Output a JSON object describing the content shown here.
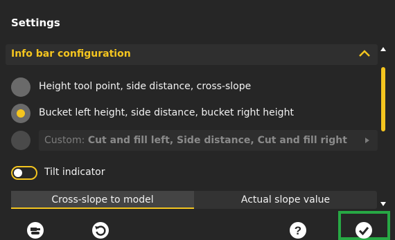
{
  "header": {
    "title": "Settings"
  },
  "section": {
    "title": "Info bar configuration",
    "expanded": true
  },
  "options": [
    {
      "label": "Height tool point, side distance, cross-slope",
      "selected": false
    },
    {
      "label": "Bucket left height, side distance, bucket right height",
      "selected": true
    }
  ],
  "custom": {
    "prefix": "Custom:",
    "value": "Cut and fill left, Side distance, Cut and fill right"
  },
  "tilt": {
    "label": "Tilt indicator",
    "enabled": false
  },
  "segmented": {
    "options": [
      "Cross-slope to model",
      "Actual slope value"
    ],
    "selected_index": 0
  },
  "bottom_bar": {
    "icons": [
      "machine-icon",
      "reset-icon",
      "help-icon",
      "confirm-icon"
    ],
    "help_glyph": "?"
  },
  "colors": {
    "background": "#262626",
    "accent": "#f4c51f",
    "confirm_frame": "#27a844",
    "text": "#f2f2f2",
    "disabled_text": "#7c7c7c"
  }
}
